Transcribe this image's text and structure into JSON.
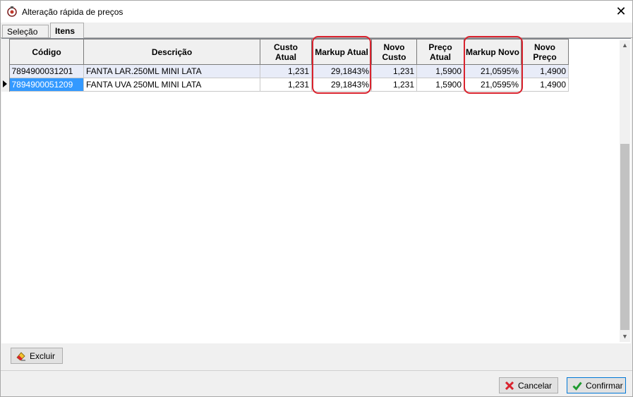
{
  "window": {
    "title": "Alteração rápida de preços",
    "close_glyph": "✕"
  },
  "tabs": [
    {
      "label": "Seleção"
    },
    {
      "label": "Itens"
    }
  ],
  "grid": {
    "columns": [
      {
        "line1": "Código",
        "line2": ""
      },
      {
        "line1": "Descrição",
        "line2": ""
      },
      {
        "line1": "Custo",
        "line2": "Atual"
      },
      {
        "line1": "Markup Atual",
        "line2": ""
      },
      {
        "line1": "Novo",
        "line2": "Custo"
      },
      {
        "line1": "Preço",
        "line2": "Atual"
      },
      {
        "line1": "Markup Novo",
        "line2": ""
      },
      {
        "line1": "Novo",
        "line2": "Preço"
      }
    ],
    "rows": [
      {
        "codigo": "7894900031201",
        "descricao": "FANTA LAR.250ML MINI LATA",
        "custo_atual": "1,231",
        "markup_atual": "29,1843%",
        "novo_custo": "1,231",
        "preco_atual": "1,5900",
        "markup_novo": "21,0595%",
        "novo_preco": "1,4900"
      },
      {
        "codigo": "7894900051209",
        "descricao": "FANTA UVA 250ML MINI LATA",
        "custo_atual": "1,231",
        "markup_atual": "29,1843%",
        "novo_custo": "1,231",
        "preco_atual": "1,5900",
        "markup_novo": "21,0595%",
        "novo_preco": "1,4900"
      }
    ],
    "selected_row": 1
  },
  "buttons": {
    "excluir": "Excluir",
    "cancelar": "Cancelar",
    "confirmar": "Confirmar"
  },
  "colors": {
    "highlight": "#d9232e",
    "selection": "#3399ff"
  }
}
